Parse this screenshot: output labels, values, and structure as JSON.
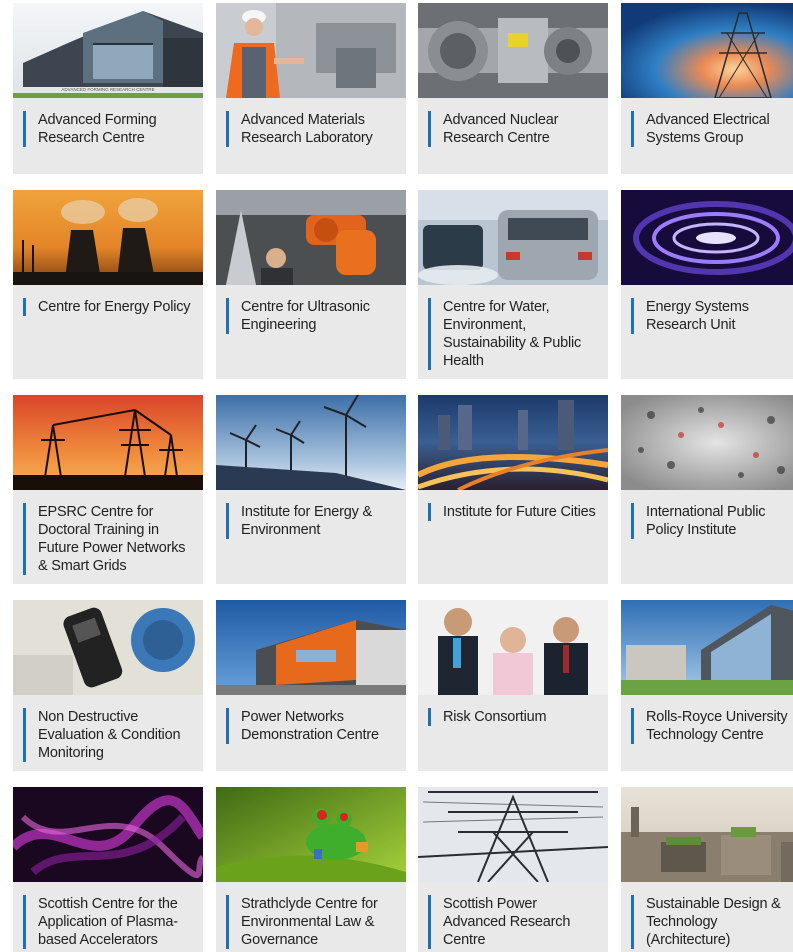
{
  "accent_color": "#1f6fb2",
  "cards": [
    {
      "label": "Advanced Forming Research Centre",
      "image": "modern-glass-building-photo",
      "image_caption": "ADVANCED FORMING RESEARCH CENTRE"
    },
    {
      "label": "Advanced Materials Research Laboratory",
      "image": "lab-worker-hardhat-photo"
    },
    {
      "label": "Advanced Nuclear Research Centre",
      "image": "metal-pipe-machinery-photo"
    },
    {
      "label": "Advanced Electrical Systems Group",
      "image": "pylon-sunset-blue-photo"
    },
    {
      "label": "Centre for Energy Policy",
      "image": "power-station-cooling-towers-photo"
    },
    {
      "label": "Centre for Ultrasonic Engineering",
      "image": "orange-robot-arm-photo"
    },
    {
      "label": "Centre for Water, Environment, Sustainability & Public Health",
      "image": "traffic-jam-exhaust-photo"
    },
    {
      "label": "Energy Systems Research Unit",
      "image": "purple-plasma-ring-photo"
    },
    {
      "label": "EPSRC Centre for Doctoral Training in Future Power Networks & Smart Grids",
      "image": "substation-orange-sky-photo"
    },
    {
      "label": "Institute for Energy & Environment",
      "image": "wind-turbines-solar-photo"
    },
    {
      "label": "Institute for Future Cities",
      "image": "city-highway-night-photo"
    },
    {
      "label": "International Public Policy Institute",
      "image": "crowd-motion-blur-photo"
    },
    {
      "label": "Non Destructive Evaluation & Condition Monitoring",
      "image": "motor-sensor-device-photo"
    },
    {
      "label": "Power Networks Demonstration Centre",
      "image": "orange-building-blue-sky-photo"
    },
    {
      "label": "Risk Consortium",
      "image": "business-people-meeting-photo"
    },
    {
      "label": "Rolls-Royce University Technology Centre",
      "image": "modern-campus-building-photo"
    },
    {
      "label": "Scottish Centre for the Application of Plasma-based Accelerators",
      "image": "magenta-plasma-wisps-photo"
    },
    {
      "label": "Strathclyde Centre for Environmental Law & Governance",
      "image": "green-tree-frog-photo"
    },
    {
      "label": "Scottish Power Advanced Research Centre",
      "image": "transmission-tower-photo"
    },
    {
      "label": "Sustainable Design & Technology (Architecture)",
      "image": "city-rooftops-photo"
    }
  ]
}
